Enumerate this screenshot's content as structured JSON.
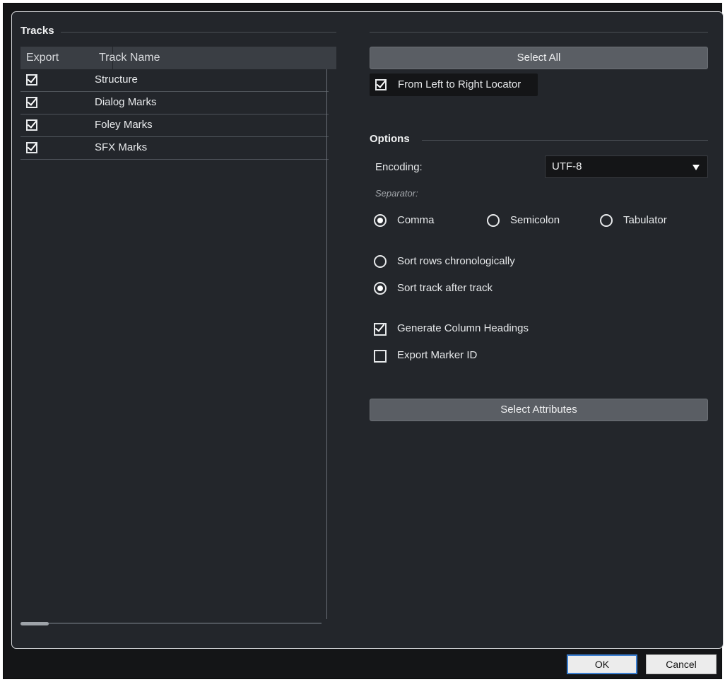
{
  "tracks": {
    "title": "Tracks",
    "columns": {
      "export": "Export",
      "track_name": "Track Name"
    },
    "rows": [
      {
        "export": true,
        "name": "Structure"
      },
      {
        "export": true,
        "name": "Dialog Marks"
      },
      {
        "export": true,
        "name": "Foley Marks"
      },
      {
        "export": true,
        "name": "SFX Marks"
      }
    ]
  },
  "range": {
    "select_all_label": "Select All",
    "from_left_to_right_locator": {
      "label": "From Left to Right Locator",
      "checked": true
    }
  },
  "options": {
    "title": "Options",
    "encoding": {
      "label": "Encoding:",
      "value": "UTF-8"
    },
    "separator": {
      "label": "Separator:",
      "choices": [
        {
          "label": "Comma",
          "selected": true
        },
        {
          "label": "Semicolon",
          "selected": false
        },
        {
          "label": "Tabulator",
          "selected": false
        }
      ]
    },
    "sort": [
      {
        "label": "Sort rows chronologically",
        "selected": false
      },
      {
        "label": "Sort track after track",
        "selected": true
      }
    ],
    "generate_column_headings": {
      "label": "Generate Column Headings",
      "checked": true
    },
    "export_marker_id": {
      "label": "Export Marker ID",
      "checked": false
    },
    "select_attributes_label": "Select Attributes"
  },
  "footer": {
    "ok_label": "OK",
    "cancel_label": "Cancel"
  }
}
